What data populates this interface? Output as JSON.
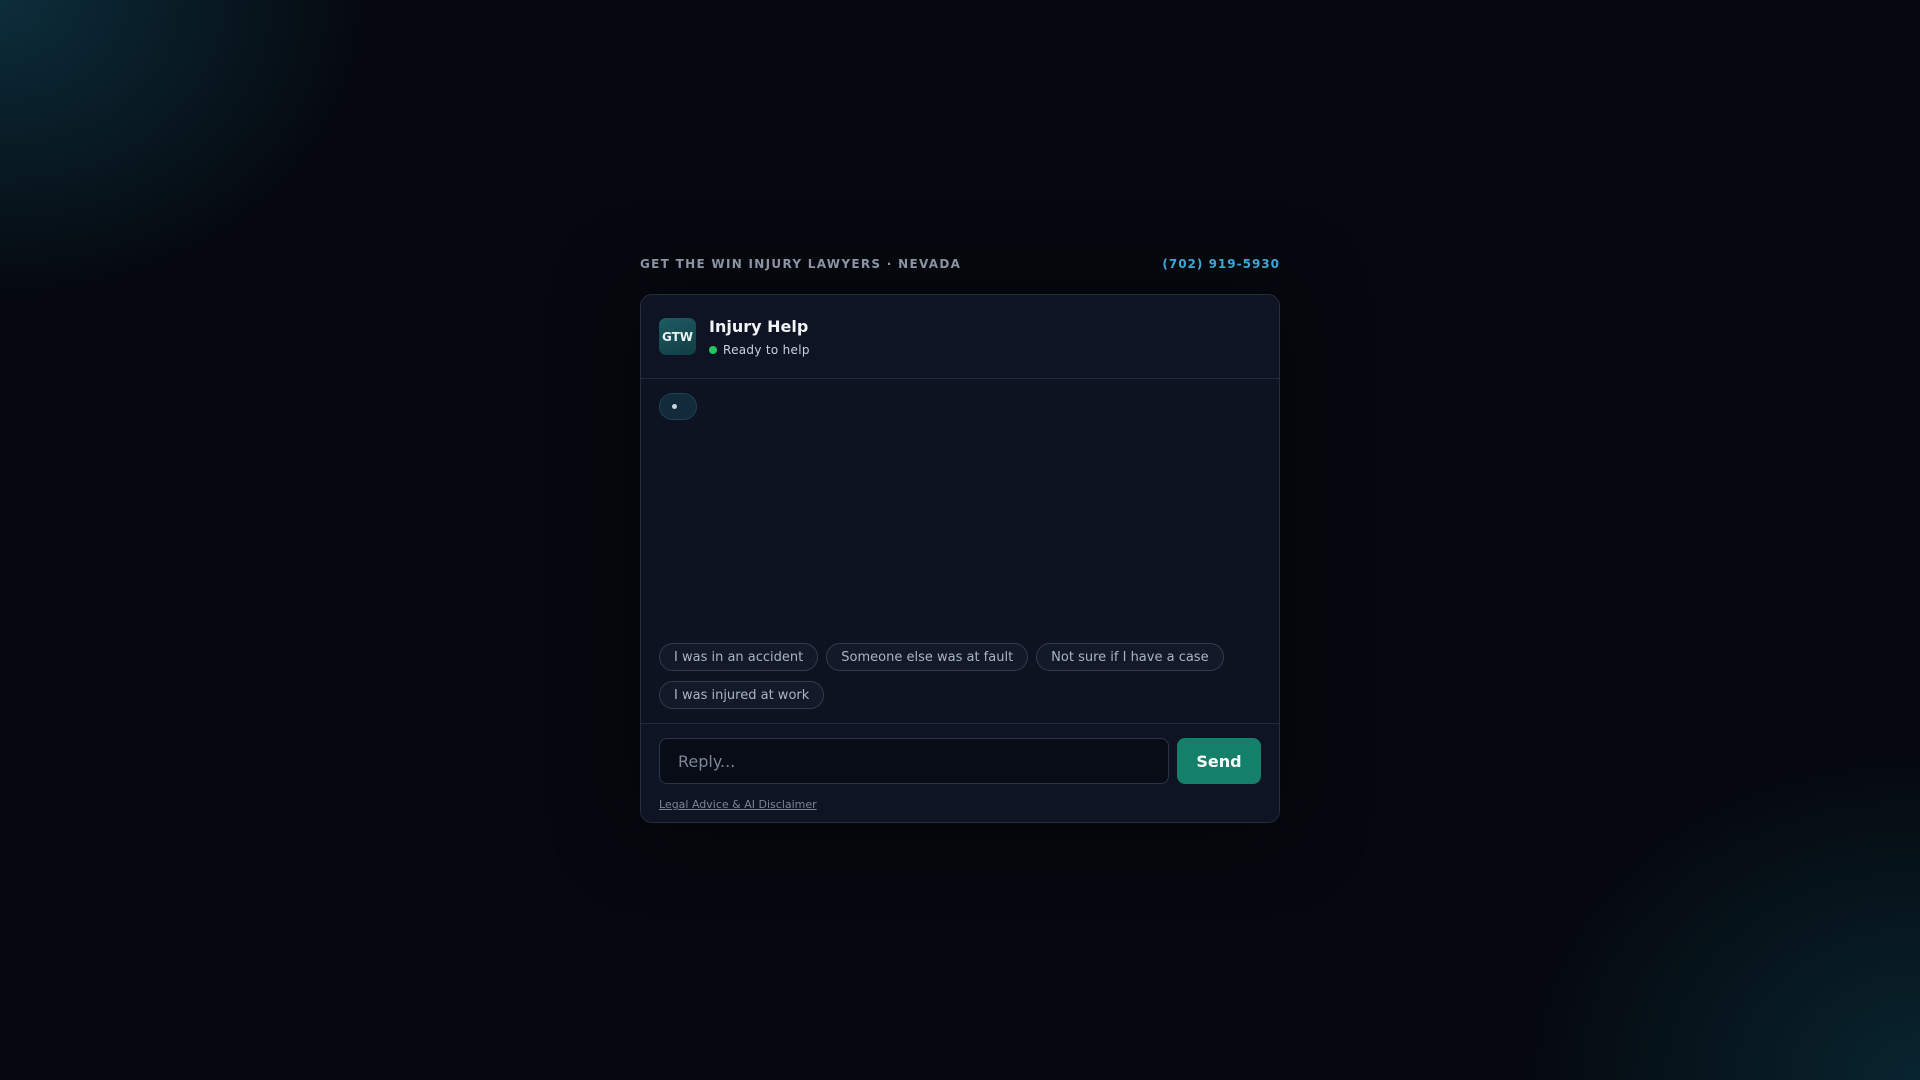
{
  "brand": {
    "label": "GET THE WIN INJURY LAWYERS · NEVADA",
    "phone": "(702) 919-5930"
  },
  "chat": {
    "avatar_text": "GTW",
    "title": "Injury Help",
    "status_text": "Ready to help",
    "status_color": "#22c55e"
  },
  "quick_replies": [
    {
      "label": "I was in an accident"
    },
    {
      "label": "Someone else was at fault"
    },
    {
      "label": "Not sure if I have a case"
    },
    {
      "label": "I was injured at work"
    }
  ],
  "composer": {
    "placeholder": "Reply...",
    "value": "",
    "send_label": "Send",
    "send_color": "#15806a"
  },
  "footer": {
    "disclaimer_label": "Legal Advice & AI Disclaimer"
  },
  "icons": {
    "status": "online-dot-icon",
    "typing": "typing-indicator-icon"
  }
}
